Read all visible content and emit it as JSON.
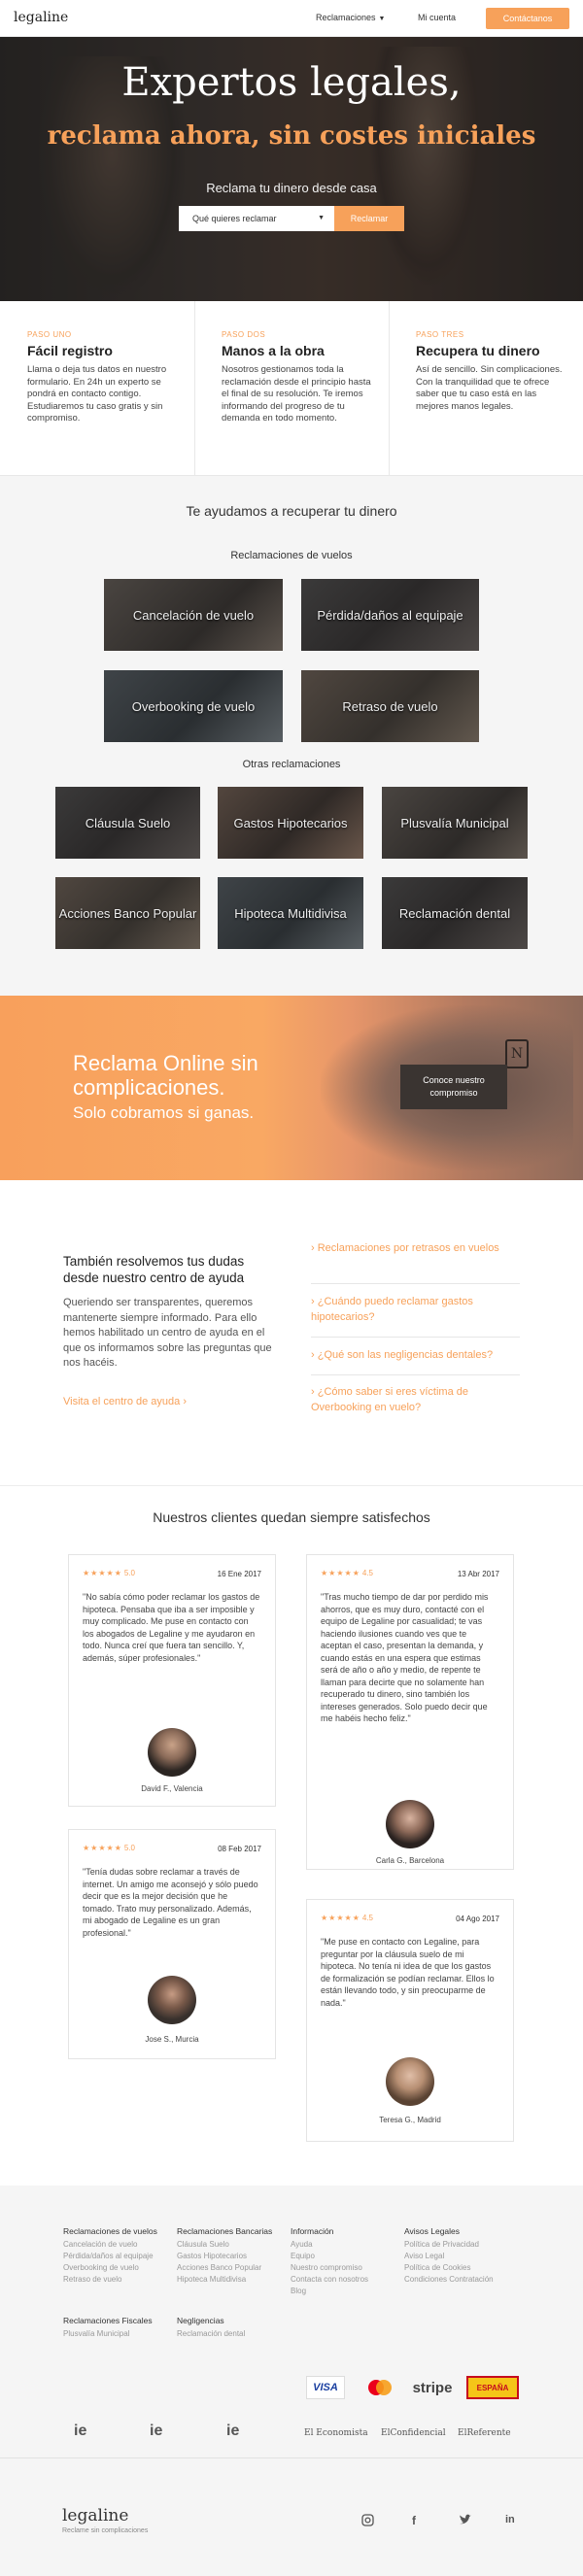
{
  "header": {
    "logo": "legaline",
    "nav_reclamaciones": "Reclamaciones",
    "nav_cuenta": "Mi cuenta",
    "contact_button": "Contáctanos"
  },
  "hero": {
    "title": "Expertos legales,",
    "subtitle": "reclama ahora, sin costes iniciales",
    "lead": "Reclama tu dinero desde casa",
    "select_value": "Qué quieres reclamar",
    "button": "Reclamar"
  },
  "steps": [
    {
      "kicker": "PASO UNO",
      "title": "Fácil registro",
      "body": "Llama o deja tus datos en nuestro formulario. En 24h un experto se pondrá en contacto contigo. Estudiaremos tu caso gratis y sin compromiso."
    },
    {
      "kicker": "PASO DOS",
      "title": "Manos a la obra",
      "body": "Nosotros gestionamos toda la reclamación desde el principio hasta el final de su resolución. Te iremos informando del progreso de tu demanda en todo momento."
    },
    {
      "kicker": "PASO TRES",
      "title": "Recupera tu dinero",
      "body": "Así de sencillo. Sin complicaciones. Con la tranquilidad que te ofrece saber que tu caso está en las mejores manos legales."
    }
  ],
  "claims": {
    "heading": "Te ayudamos a recuperar tu dinero",
    "flights_heading": "Reclamaciones de vuelos",
    "flights": [
      "Cancelación de vuelo",
      "Pérdida/daños al equipaje",
      "Overbooking de vuelo",
      "Retraso de vuelo"
    ],
    "others_heading": "Otras reclamaciones",
    "others": [
      "Cláusula Suelo",
      "Gastos Hipotecarios",
      "Plusvalía Municipal",
      "Acciones Banco Popular",
      "Hipoteca Multidivisa",
      "Reclamación dental"
    ]
  },
  "banner": {
    "line1": "Reclama Online sin",
    "line2": "complicaciones.",
    "line3": "Solo cobramos si ganas.",
    "button": "Conoce nuestro compromiso",
    "tag_letter": "N"
  },
  "faq": {
    "title": "También resolvemos tus dudas desde nuestro centro de ayuda",
    "body": "Queriendo ser transparentes, queremos mantenerte siempre informado. Para ello hemos habilitado un centro de ayuda en el que os informamos sobre las preguntas que nos hacéis.",
    "link": "Visita el centro de ayuda ›",
    "items": [
      "› Reclamaciones por retrasos en vuelos",
      "› ¿Cuándo puedo reclamar gastos hipotecarios?",
      "› ¿Qué son las negligencias dentales?",
      "› ¿Cómo saber si eres víctima de Overbooking en vuelo?"
    ]
  },
  "testimonials": {
    "heading": "Nuestros clientes quedan siempre satisfechos",
    "items": [
      {
        "stars": "★★★★★",
        "score": "5.0",
        "date": "16 Ene 2017",
        "quote": "\"No sabía cómo poder reclamar los gastos de hipoteca. Pensaba que iba a ser imposible y muy complicado. Me puse en contacto con los abogados de Legaline y me ayudaron en todo. Nunca creí que fuera tan sencillo. Y, además, súper profesionales.\"",
        "author": "David F., Valencia"
      },
      {
        "stars": "★★★★★",
        "score": "4.5",
        "date": "13 Abr 2017",
        "quote": "\"Tras mucho tiempo de dar por perdido mis ahorros, que es muy duro, contacté con el equipo de Legaline por casualidad; te vas haciendo ilusiones cuando ves que te aceptan el caso, presentan la demanda, y cuando estás en una espera que estimas será de año o año y medio, de repente te llaman para decirte que no solamente han recuperado tu dinero, sino también los intereses generados. Solo puedo decir que me habéis hecho feliz.\"",
        "author": "Carla G., Barcelona"
      },
      {
        "stars": "★★★★★",
        "score": "5.0",
        "date": "08 Feb 2017",
        "quote": "\"Tenía dudas sobre reclamar a través de internet. Un amigo me aconsejó y sólo puedo decir que es la mejor decisión que he tomado. Trato muy personalizado. Además, mi abogado de Legaline es un gran profesional.\"",
        "author": "Jose S., Murcia"
      },
      {
        "stars": "★★★★★",
        "score": "4.5",
        "date": "04 Ago 2017",
        "quote": "\"Me puse en contacto con Legaline, para preguntar por la cláusula suelo de mi hipoteca. No tenía ni idea de que los gastos de formalización se podían reclamar. Ellos lo están llevando todo, y sin preocuparme de nada.\"",
        "author": "Teresa G., Madrid"
      }
    ]
  },
  "footer": {
    "columns": [
      {
        "heading": "Reclamaciones de vuelos",
        "items": [
          "Cancelación de vuelo",
          "Pérdida/daños al equipaje",
          "Overbooking de vuelo",
          "Retraso de vuelo"
        ]
      },
      {
        "heading": "Reclamaciones Bancarias",
        "items": [
          "Cláusula Suelo",
          "Gastos Hipotecarios",
          "Acciones Banco Popular",
          "Hipoteca Multidivisa"
        ]
      },
      {
        "heading": "Información",
        "items": [
          "Ayuda",
          "Equipo",
          "Nuestro compromiso",
          "Contacta con nosotros",
          "Blog"
        ]
      },
      {
        "heading": "Avisos Legales",
        "items": [
          "Política de Privacidad",
          "Aviso Legal",
          "Política de Cookies",
          "Condiciones Contratación"
        ]
      },
      {
        "heading": "Reclamaciones Fiscales",
        "items": [
          "Plusvalía Municipal"
        ]
      },
      {
        "heading": "Negligencias",
        "items": [
          "Reclamación dental"
        ]
      }
    ],
    "payments": [
      "VISA",
      "mastercard",
      "stripe",
      "ESPAÑA"
    ],
    "press": [
      "ie",
      "ie",
      "ie",
      "El Economista",
      "ElConfidencial",
      "ElReferente"
    ],
    "logo": "legaline",
    "tagline": "Reclame sin complicaciones",
    "social": [
      "instagram",
      "facebook",
      "twitter",
      "linkedin"
    ]
  }
}
